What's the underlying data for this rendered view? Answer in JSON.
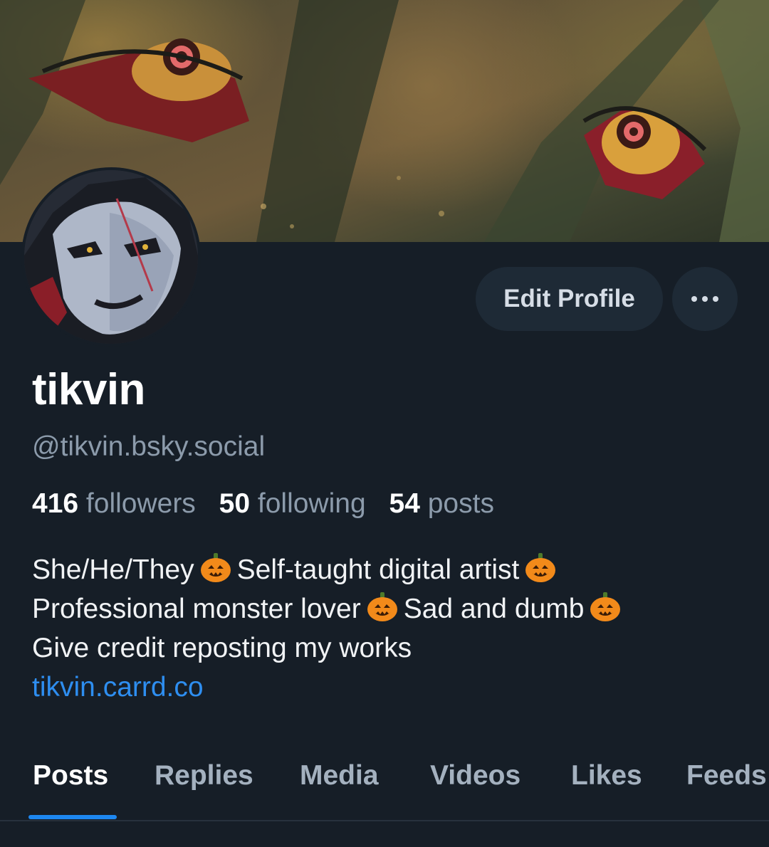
{
  "profile": {
    "display_name": "tikvin",
    "handle": "@tikvin.bsky.social",
    "banner_icon": "illustrated-banner",
    "avatar_icon": "painted-avatar"
  },
  "actions": {
    "edit_profile_label": "Edit Profile",
    "more_icon": "ellipsis-icon"
  },
  "stats": {
    "followers_count": "416",
    "followers_label": "followers",
    "following_count": "50",
    "following_label": "following",
    "posts_count": "54",
    "posts_label": "posts"
  },
  "bio": {
    "line1_a": "She/He/They",
    "line1_b": "Self-taught digital artist",
    "line2_a": "Professional monster lover",
    "line2_b": "Sad and dumb",
    "line3": "Give credit reposting my works",
    "link": "tikvin.carrd.co",
    "emoji_icon": "jack-o-lantern-icon"
  },
  "tabs": [
    {
      "label": "Posts",
      "active": true
    },
    {
      "label": "Replies",
      "active": false
    },
    {
      "label": "Media",
      "active": false
    },
    {
      "label": "Videos",
      "active": false
    },
    {
      "label": "Likes",
      "active": false
    },
    {
      "label": "Feeds",
      "active": false
    }
  ],
  "colors": {
    "background": "#161e27",
    "button_bg": "#1e2a36",
    "accent_link": "#2e8ef0",
    "tab_underline": "#1d87f0",
    "muted_text": "#8c9bab"
  }
}
